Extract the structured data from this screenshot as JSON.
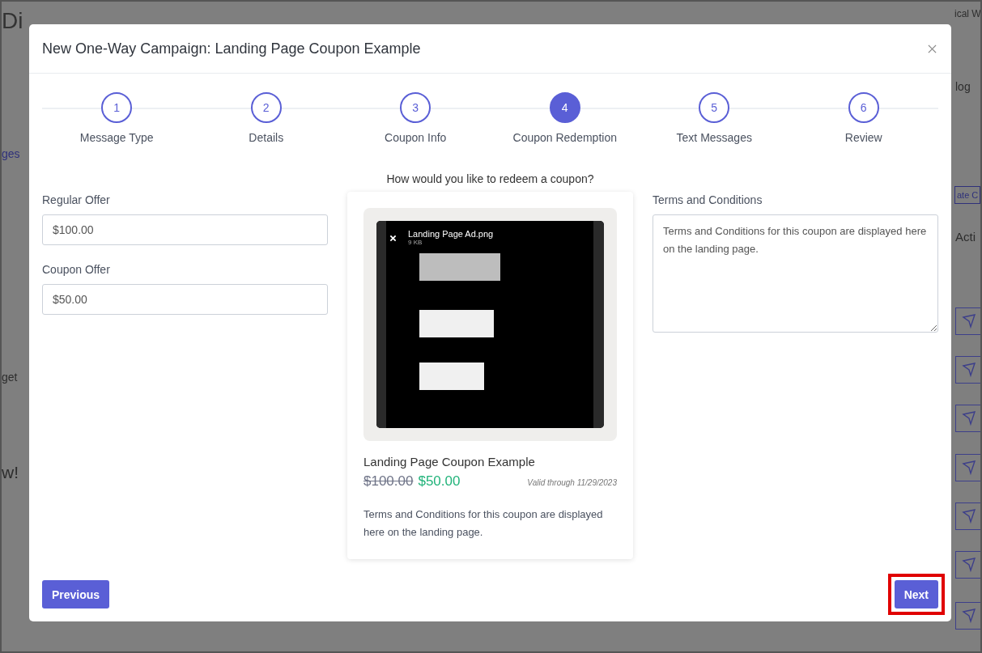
{
  "background_texts": [
    {
      "kind": "title",
      "text": "Di"
    },
    {
      "kind": "user",
      "text": "ical W"
    },
    {
      "kind": "crumb",
      "text": "log"
    },
    {
      "kind": "link",
      "text": "ges"
    },
    {
      "kind": "button",
      "text": "ate C"
    },
    {
      "kind": "heading",
      "text": "Acti"
    },
    {
      "kind": "plain",
      "text": "get"
    },
    {
      "kind": "big",
      "text": "w!"
    }
  ],
  "modal": {
    "title": "New One-Way Campaign: Landing Page Coupon Example",
    "steps": [
      {
        "number": "1",
        "label": "Message Type",
        "selected": false
      },
      {
        "number": "2",
        "label": "Details",
        "selected": false
      },
      {
        "number": "3",
        "label": "Coupon Info",
        "selected": false
      },
      {
        "number": "4",
        "label": "Coupon Redemption",
        "selected": true
      },
      {
        "number": "5",
        "label": "Text Messages",
        "selected": false
      },
      {
        "number": "6",
        "label": "Review",
        "selected": false
      }
    ],
    "question": "How would you like to redeem a coupon?",
    "fields": [
      {
        "label": "Regular Offer",
        "value": "$100.00"
      },
      {
        "label": "Coupon Offer",
        "value": "$50.00"
      }
    ],
    "preview": {
      "file_name": "Landing Page Ad.png",
      "file_size": "9 KB",
      "title": "Landing Page Coupon Example",
      "old_price": "$100.00",
      "new_price": "$50.00",
      "valid": "Valid through 11/29/2023",
      "terms": "Terms and Conditions for this coupon are displayed here on the landing page."
    },
    "terms": {
      "label": "Terms and Conditions",
      "value": "Terms and Conditions for this coupon are displayed here on the landing page."
    },
    "buttons": {
      "previous": "Previous",
      "next": "Next",
      "next_highlighted": true
    }
  }
}
